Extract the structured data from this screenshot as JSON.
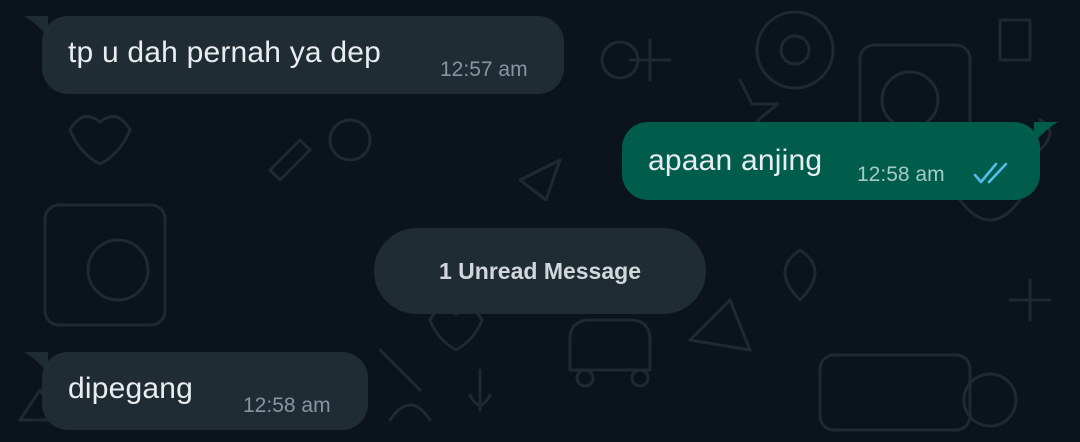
{
  "colors": {
    "background": "#0b141a",
    "incoming_bubble": "#202c33",
    "outgoing_bubble": "#005c4b",
    "read_ticks": "#53bdeb"
  },
  "messages": [
    {
      "direction": "incoming",
      "text": "tp u dah pernah ya dep",
      "time": "12:57 am"
    },
    {
      "direction": "outgoing",
      "text": "apaan anjing",
      "time": "12:58 am",
      "status_icon": "double-check-read-icon"
    },
    {
      "direction": "incoming",
      "text": "dipegang",
      "time": "12:58 am"
    }
  ],
  "unread_divider": {
    "label": "1 Unread Message"
  }
}
